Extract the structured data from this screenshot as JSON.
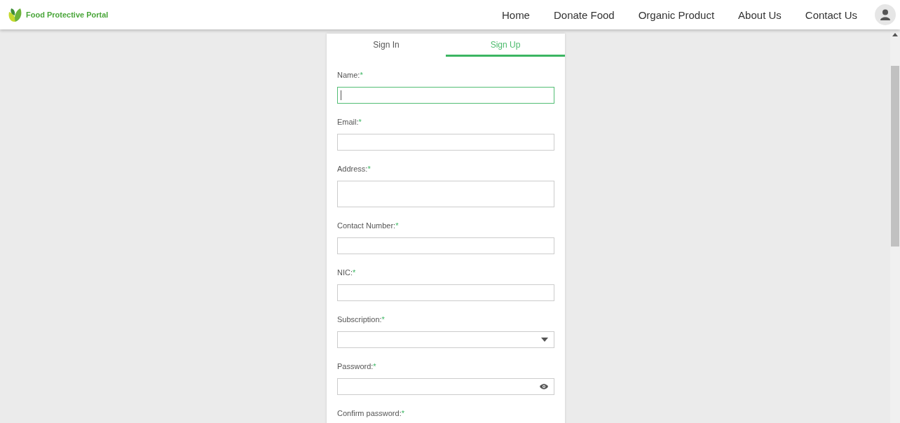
{
  "header": {
    "brand": "Food Protective Portal",
    "nav": [
      {
        "label": "Home"
      },
      {
        "label": "Donate Food"
      },
      {
        "label": "Organic Product"
      },
      {
        "label": "About Us"
      },
      {
        "label": "Contact Us"
      }
    ]
  },
  "tabs": [
    {
      "label": "Sign In",
      "selected": false
    },
    {
      "label": "Sign Up",
      "selected": true
    }
  ],
  "fields": [
    {
      "label": "Name:",
      "required_mark": "*",
      "kind": "text",
      "focused": true
    },
    {
      "label": "Email:",
      "required_mark": "*",
      "kind": "text",
      "focused": false
    },
    {
      "label": "Address:",
      "required_mark": "*",
      "kind": "textarea",
      "focused": false
    },
    {
      "label": "Contact Number:",
      "required_mark": "*",
      "kind": "text",
      "focused": false
    },
    {
      "label": "NIC:",
      "required_mark": "*",
      "kind": "text",
      "focused": false
    },
    {
      "label": "Subscription:",
      "required_mark": "*",
      "kind": "select",
      "focused": false
    },
    {
      "label": "Password:",
      "required_mark": "*",
      "kind": "password",
      "focused": false
    },
    {
      "label": "Confirm password:",
      "required_mark": "*",
      "kind": "label_only",
      "focused": false
    }
  ]
}
